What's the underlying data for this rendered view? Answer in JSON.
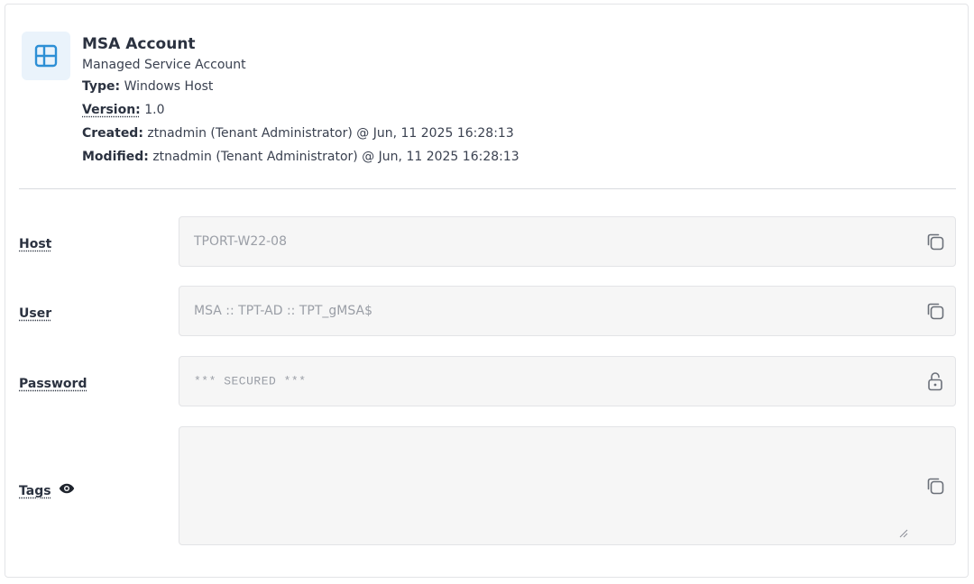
{
  "header": {
    "icon": "windows-icon",
    "title": "MSA Account",
    "subtitle": "Managed Service Account",
    "type_label": "Type:",
    "type_value": " Windows Host",
    "version_label": "Version:",
    "version_value": " 1.0",
    "created_label": "Created:",
    "created_value": " ztnadmin (Tenant Administrator) @ Jun, 11 2025 16:28:13",
    "modified_label": "Modified:",
    "modified_value": " ztnadmin (Tenant Administrator) @ Jun, 11 2025 16:28:13"
  },
  "fields": {
    "host": {
      "label": "Host",
      "value": "TPORT-W22-08",
      "action_icon": "copy-icon"
    },
    "user": {
      "label": "User",
      "value": "MSA :: TPT-AD :: TPT_gMSA$",
      "action_icon": "copy-icon"
    },
    "password": {
      "label": "Password",
      "value": "*** SECURED ***",
      "action_icon": "unlock-icon"
    },
    "tags": {
      "label": "Tags",
      "label_icon": "eye-icon",
      "value": "",
      "action_icon": "copy-icon"
    }
  },
  "colors": {
    "accent": "#2d8fd5",
    "icon_bg": "#eaf3fb",
    "field_bg": "#f6f6f6",
    "field_border": "#e3e4e7",
    "muted_text": "#9a9ea6"
  }
}
